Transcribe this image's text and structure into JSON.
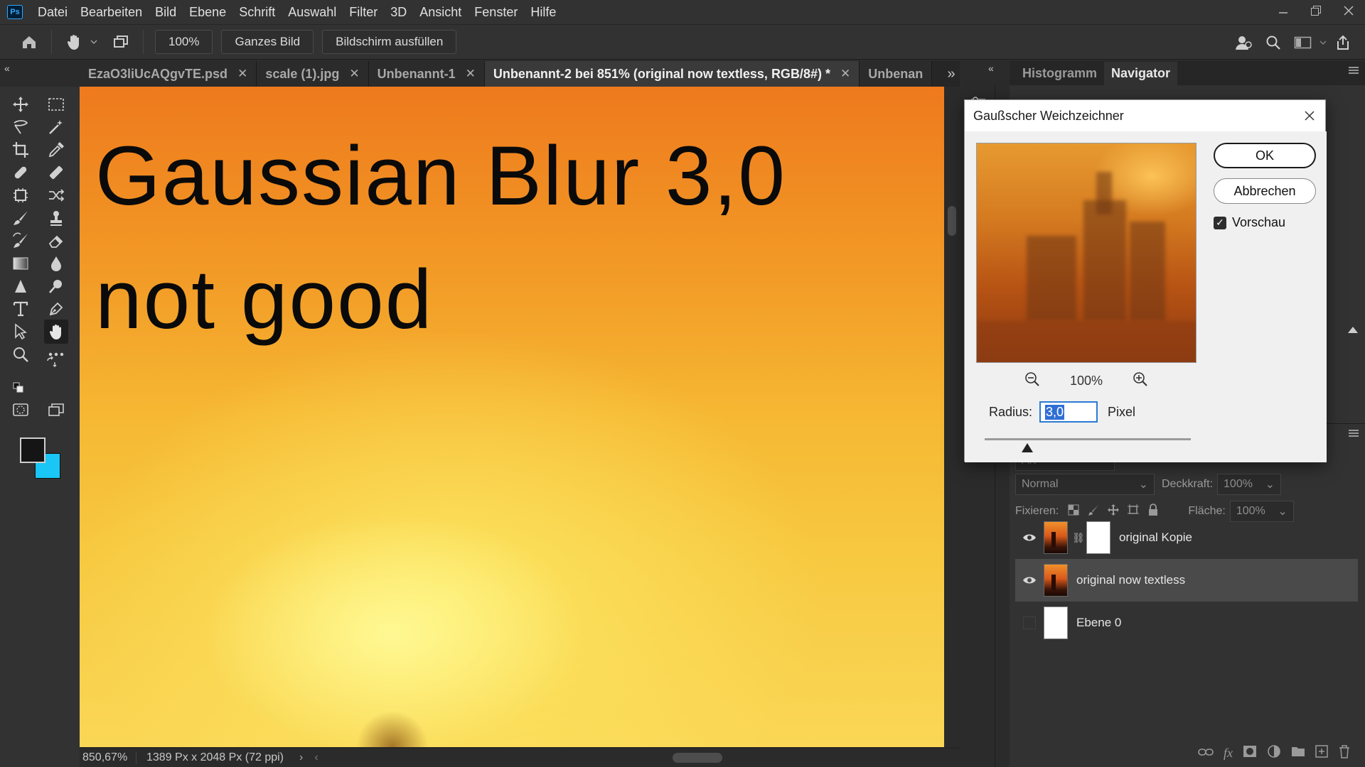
{
  "app": {
    "logo": "Ps"
  },
  "menu": [
    "Datei",
    "Bearbeiten",
    "Bild",
    "Ebene",
    "Schrift",
    "Auswahl",
    "Filter",
    "3D",
    "Ansicht",
    "Fenster",
    "Hilfe"
  ],
  "options": {
    "zoom": "100%",
    "fit_screen": "Ganzes Bild",
    "fill_screen": "Bildschirm ausfüllen"
  },
  "tabs": [
    {
      "label": "EzaO3liUcAQgvTE.psd",
      "active": false
    },
    {
      "label": "scale (1).jpg",
      "active": false
    },
    {
      "label": "Unbenannt-1",
      "active": false
    },
    {
      "label": "Unbenannt-2 bei 851% (original now textless, RGB/8#) *",
      "active": true
    },
    {
      "label": "Unbenan",
      "active": false
    }
  ],
  "canvas": {
    "line1": "Gaussian Blur 3,0",
    "line2": "not good"
  },
  "status": {
    "zoom": "850,67%",
    "doc": "1389 Px x 2048 Px (72 ppi)"
  },
  "colors": {
    "foreground": "#151515",
    "background": "#1ac6f5",
    "accent": "#31a8ff"
  },
  "navigator": {
    "tabs": [
      "Histogramm",
      "Navigator"
    ],
    "active": "Navigator"
  },
  "dialog": {
    "title": "Gaußscher Weichzeichner",
    "ok": "OK",
    "cancel": "Abbrechen",
    "preview_label": "Vorschau",
    "preview_checked": true,
    "zoom": "100%",
    "radius_label": "Radius:",
    "radius_value": "3,0",
    "radius_unit": "Pixel"
  },
  "layers": {
    "filter_placeholder": "Art",
    "blend_mode": "Normal",
    "opacity_label": "Deckkraft:",
    "opacity_value": "100%",
    "lock_label": "Fixieren:",
    "fill_label": "Fläche:",
    "fill_value": "100%",
    "items": [
      {
        "name": "original Kopie",
        "visible": true,
        "has_mask": true,
        "selected": false
      },
      {
        "name": "original now textless",
        "visible": true,
        "has_mask": false,
        "selected": true
      },
      {
        "name": "Ebene 0",
        "visible": false,
        "has_mask": false,
        "selected": false
      }
    ]
  },
  "icons": [
    "home-icon",
    "hand-icon",
    "arrange-icon",
    "search-icon",
    "share-icon",
    "user-icon",
    "workspace-icon",
    "eye-icon",
    "link-icon",
    "fx-icon",
    "mask-icon",
    "adjustment-icon",
    "folder-icon",
    "new-layer-icon",
    "trash-icon",
    "zoom-out-icon",
    "zoom-in-icon",
    "close-icon"
  ]
}
